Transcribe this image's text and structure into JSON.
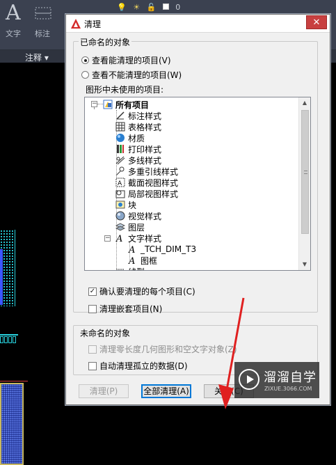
{
  "cad": {
    "ribbon": {
      "text_label": "文字",
      "dim_label": "标注",
      "big_A": "A",
      "layer_value": "0"
    },
    "panel_title": "注释 ▾"
  },
  "dialog": {
    "title": "清理",
    "close_glyph": "✕",
    "named_group": {
      "title": "已命名的对象",
      "radio_purgeable": "查看能清理的项目(V)",
      "radio_nonpurgeable": "查看不能清理的项目(W)",
      "tree_label": "图形中未使用的项目:",
      "tree": {
        "root": "所有项目",
        "items": [
          "标注样式",
          "表格样式",
          "材质",
          "打印样式",
          "多线样式",
          "多重引线样式",
          "截面视图样式",
          "局部视图样式",
          "块",
          "视觉样式",
          "图层",
          "文字样式"
        ],
        "text_style_children": [
          "_TCH_DIM_T3",
          "图框"
        ],
        "partial_item": "线型"
      },
      "confirm_each": "确认要清理的每个项目(C)",
      "purge_nested": "清理嵌套项目(N)"
    },
    "unnamed_group": {
      "title": "未命名的对象",
      "zero_length": "清理零长度几何图形和空文字对象(Z)",
      "orphan_data": "自动清理孤立的数据(D)"
    },
    "buttons": {
      "purge": "清理(P)",
      "purge_all": "全部清理(A)",
      "close": "关闭(C)"
    }
  },
  "watermark": {
    "name": "溜溜自学",
    "url": "ZIXUE.3066.COM"
  },
  "colors": {
    "accent": "#0078d7",
    "close_red": "#c84040",
    "arrow_red": "#e02020",
    "cad_cyan": "#29d3e0"
  }
}
